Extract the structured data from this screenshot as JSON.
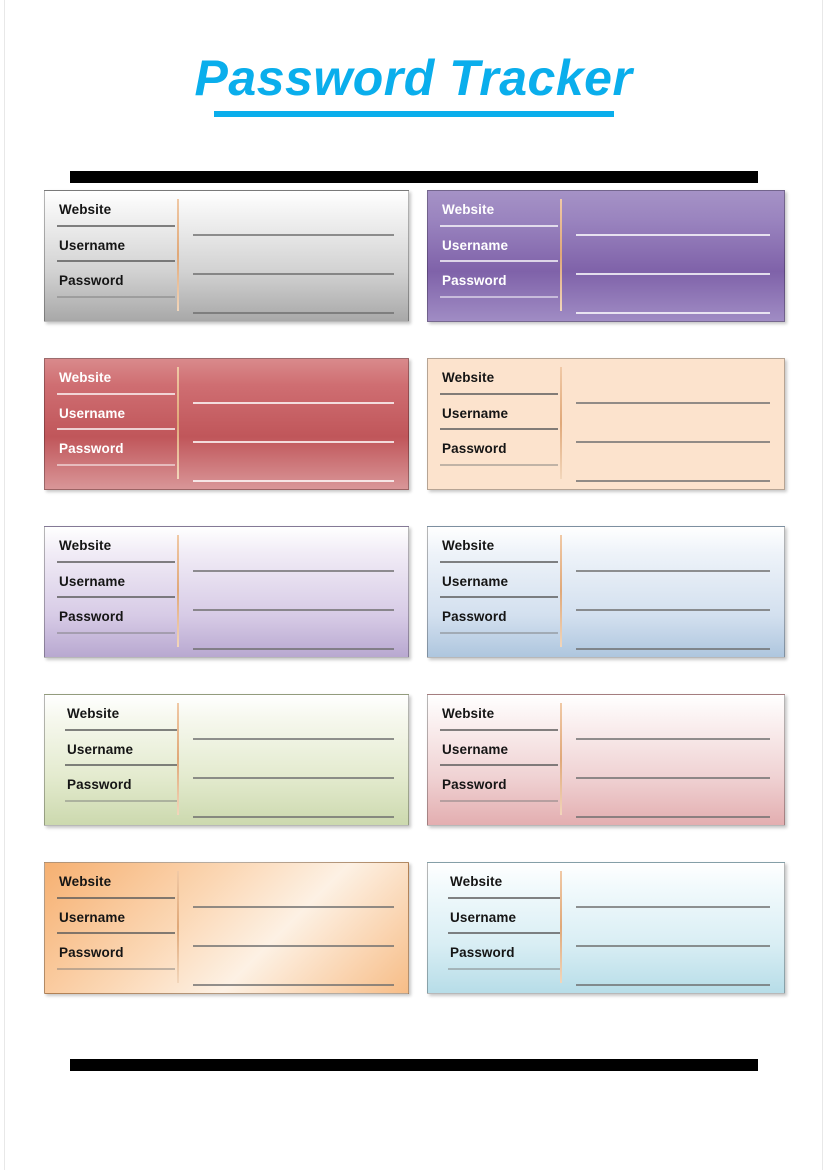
{
  "document": {
    "title": "Password Tracker",
    "type": "printable-form-template"
  },
  "header": {
    "title": "Password Tracker",
    "title_color": "#0aaeec",
    "underline_color": "#0aaeec"
  },
  "dividers": {
    "top_rule_color": "#000000",
    "bottom_rule_color": "#000000"
  },
  "field_labels": {
    "website": "Website",
    "username": "Username",
    "password": "Password"
  },
  "entries": [
    {
      "id": "entry-1",
      "position": "row1-left",
      "color_name": "gray",
      "accent": "#9a9a9a",
      "background": "linear-gradient(to bottom, #ffffff 0%, #f2f2f2 18%, #d2d2d2 62%, #a8a8a8 100%)",
      "text_mode": "light",
      "website": "",
      "username": "",
      "password": ""
    },
    {
      "id": "entry-2",
      "position": "row1-right",
      "color_name": "purple",
      "accent": "#7d62a8",
      "background": "linear-gradient(to bottom, #a592c6 0%, #9a84bf 22%, #7f62a9 62%, #a08cc4 100%)",
      "text_mode": "dark",
      "website": "",
      "username": "",
      "password": ""
    },
    {
      "id": "entry-3",
      "position": "row2-left",
      "color_name": "red",
      "accent": "#c4595c",
      "background": "linear-gradient(to bottom, #d98a8c 0%, #cf6e72 20%, #c0565a 60%, #d99698 100%)",
      "text_mode": "dark",
      "website": "",
      "username": "",
      "password": ""
    },
    {
      "id": "entry-4",
      "position": "row2-right",
      "color_name": "peach",
      "accent": "#fae0cb",
      "background": "#fce3cd",
      "text_mode": "light",
      "website": "",
      "username": "",
      "password": ""
    },
    {
      "id": "entry-5",
      "position": "row3-left",
      "color_name": "lavender",
      "accent": "#b9aace",
      "background": "linear-gradient(to bottom, #ffffff 0%, #f1ecf6 20%, #d7cbe6 68%, #b8a8d0 100%)",
      "text_mode": "light",
      "website": "",
      "username": "",
      "password": ""
    },
    {
      "id": "entry-6",
      "position": "row3-right",
      "color_name": "steel-blue",
      "accent": "#a6bdd8",
      "background": "linear-gradient(to bottom, #ffffff 0%, #eef3f9 20%, #d3e0ef 68%, #aec6de 100%)",
      "text_mode": "light",
      "website": "",
      "username": "",
      "password": ""
    },
    {
      "id": "entry-7",
      "position": "row4-left",
      "color_name": "green",
      "accent": "#ccd6b0",
      "background": "linear-gradient(to bottom, #ffffff 0%, #f6f8ee 18%, #e4ebcf 62%, #ccd9ae 100%)",
      "text_mode": "light",
      "website": "",
      "username": "",
      "password": ""
    },
    {
      "id": "entry-8",
      "position": "row4-right",
      "color_name": "pink",
      "accent": "#e6b4b6",
      "background": "linear-gradient(to bottom, #ffffff 0%, #fbf2f2 18%, #f0d3d4 62%, #e3aeb0 100%)",
      "text_mode": "light",
      "website": "",
      "username": "",
      "password": ""
    },
    {
      "id": "entry-9",
      "position": "row5-left",
      "color_name": "orange",
      "accent": "#f0a868",
      "background": "linear-gradient(135deg, #f6b071 0%, #fbd7b4 38%, #fdf1e4 62%, #f7bd87 100%)",
      "text_mode": "light",
      "website": "",
      "username": "",
      "password": ""
    },
    {
      "id": "entry-10",
      "position": "row5-right",
      "color_name": "cyan",
      "accent": "#a8d4e0",
      "background": "linear-gradient(to bottom, #ffffff 0%, #f2fafc 18%, #d9eef4 62%, #b7dde8 100%)",
      "text_mode": "light",
      "website": "",
      "username": "",
      "password": ""
    }
  ]
}
